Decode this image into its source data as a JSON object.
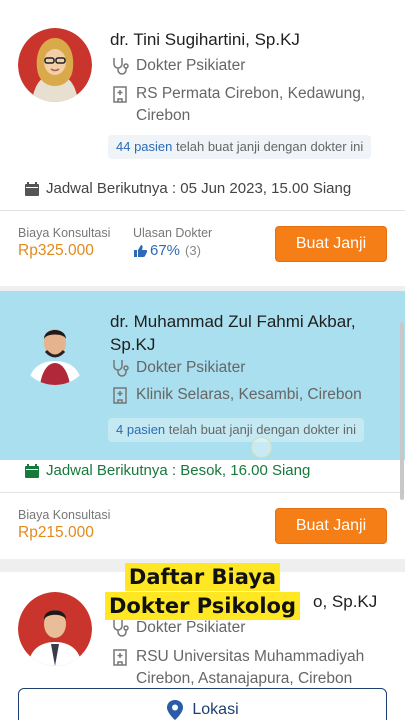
{
  "doctors": [
    {
      "name": "dr. Tini Sugihartini, Sp.KJ",
      "specialty": "Dokter Psikiater",
      "location_line1": "RS Permata Cirebon, Kedawung,",
      "location_line2": "Cirebon",
      "patients_count": "44 pasien",
      "patients_suffix": "telah buat janji dengan dokter ini",
      "schedule": "Jadwal Berikutnya : 05 Jun 2023, 15.00 Siang",
      "fee_label": "Biaya Konsultasi",
      "fee": "Rp325.000",
      "review_label": "Ulasan Dokter",
      "rating": "67%",
      "rating_count": "(3)",
      "cta": "Buat Janji"
    },
    {
      "name_line1": "dr. Muhammad Zul Fahmi Akbar,",
      "name_line2": "Sp.KJ",
      "specialty": "Dokter Psikiater",
      "location_line1": "Klinik Selaras, Kesambi, Cirebon",
      "patients_count": "4 pasien",
      "patients_suffix": "telah buat janji dengan dokter ini",
      "schedule": "Jadwal Berikutnya : Besok, 16.00 Siang",
      "fee_label": "Biaya Konsultasi",
      "fee": "Rp215.000",
      "cta": "Buat Janji"
    },
    {
      "name_tail": "o, Sp.KJ",
      "specialty": "Dokter Psikiater",
      "location_line1": "RSU Universitas Muhammadiyah",
      "location_line2": "Cirebon, Astanajapura, Cirebon"
    }
  ],
  "caption": {
    "line1": "Daftar Biaya",
    "line2": "Dokter Psikolog"
  },
  "footer": {
    "location_button": "Lokasi"
  },
  "colors": {
    "accent_orange": "#f57e17",
    "price": "#e08a1e",
    "highlight": "#a9dfee",
    "navy": "#1d3f72",
    "schedule_green": "#167a3b",
    "caption_yellow": "#ffe823"
  },
  "icons": [
    "stethoscope-icon",
    "hospital-icon",
    "calendar-icon",
    "thumbs-up-icon",
    "location-pin-icon"
  ]
}
